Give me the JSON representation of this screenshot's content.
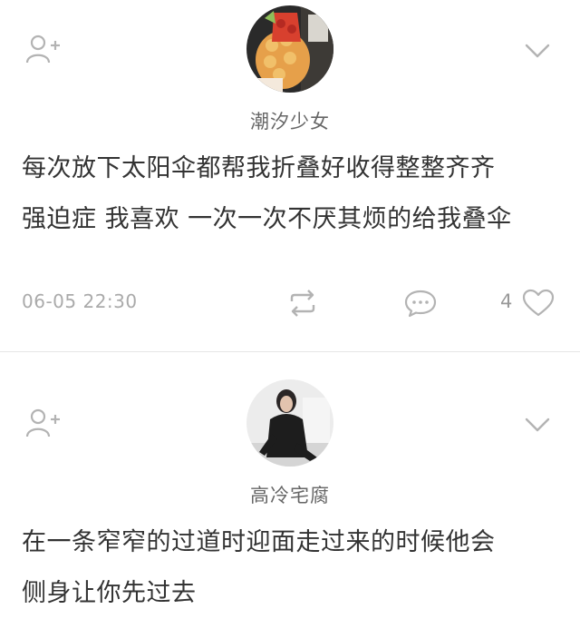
{
  "posts": [
    {
      "username": "潮汐少女",
      "content_lines": [
        "每次放下太阳伞都帮我折叠好收得整整齐齐",
        "强迫症 我喜欢 一次一次不厌其烦的给我叠伞"
      ],
      "timestamp": "06-05 22:30",
      "likes": "4",
      "avatar_icon": "avatar-food-photo"
    },
    {
      "username": "高冷宅腐",
      "content_lines": [
        "在一条窄窄的过道时迎面走过来的时候他会",
        "侧身让你先过去"
      ],
      "avatar_icon": "avatar-woman-photo"
    }
  ],
  "icons": {
    "follow": "add-friend-icon",
    "more": "chevron-down-icon",
    "repost": "repost-icon",
    "comment": "comment-icon",
    "like": "heart-icon"
  },
  "colors": {
    "text": "#333333",
    "muted": "#aaaaaa",
    "icon": "#b3b3b3",
    "divider": "#e6e6e6"
  }
}
